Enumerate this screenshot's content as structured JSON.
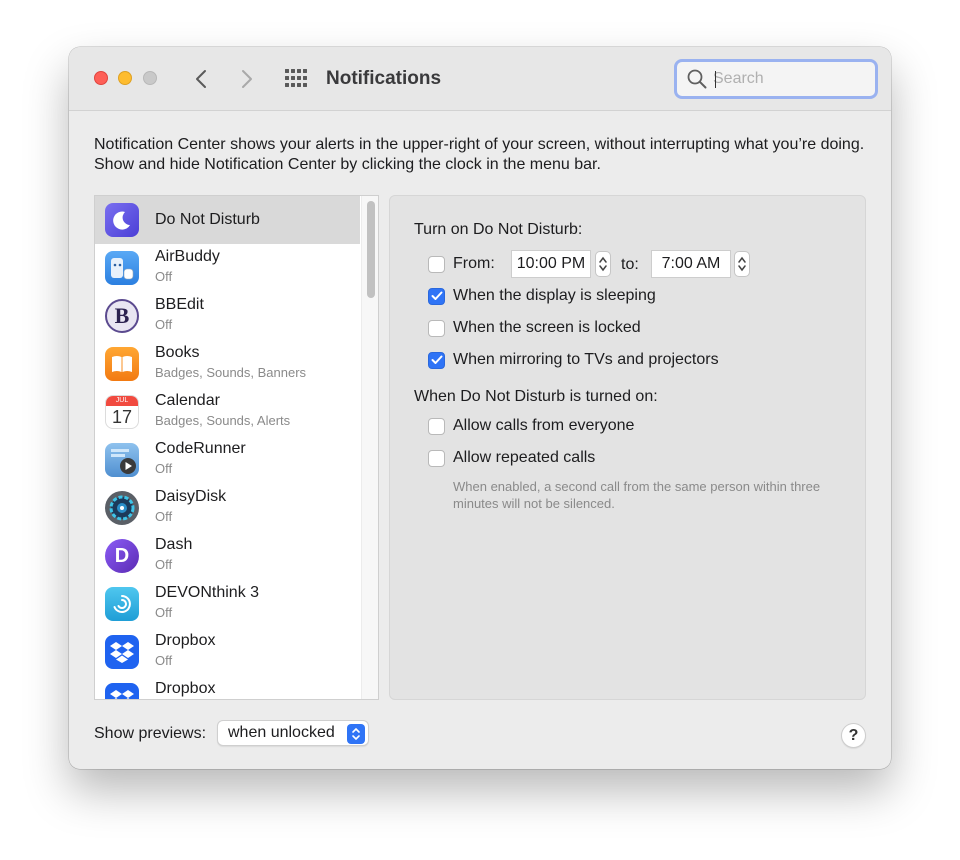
{
  "window": {
    "title": "Notifications",
    "search": {
      "placeholder": "Search",
      "value": ""
    }
  },
  "intro_text": "Notification Center shows your alerts in the upper-right of your screen, without interrupting what you’re doing. Show and hide Notification Center by clicking the clock in the menu bar.",
  "apps": [
    {
      "name": "Do Not Disturb",
      "subtitle": "",
      "icon": "moon-icon",
      "selected": true
    },
    {
      "name": "AirBuddy",
      "subtitle": "Off",
      "icon": "airbuddy-icon"
    },
    {
      "name": "BBEdit",
      "subtitle": "Off",
      "icon": "bbedit-icon"
    },
    {
      "name": "Books",
      "subtitle": "Badges, Sounds, Banners",
      "icon": "books-icon"
    },
    {
      "name": "Calendar",
      "subtitle": "Badges, Sounds, Alerts",
      "icon": "calendar-icon",
      "icon_month": "JUL",
      "icon_day": "17"
    },
    {
      "name": "CodeRunner",
      "subtitle": "Off",
      "icon": "coderunner-icon"
    },
    {
      "name": "DaisyDisk",
      "subtitle": "Off",
      "icon": "daisydisk-icon"
    },
    {
      "name": "Dash",
      "subtitle": "Off",
      "icon": "dash-icon"
    },
    {
      "name": "DEVONthink 3",
      "subtitle": "Off",
      "icon": "devonthink-icon"
    },
    {
      "name": "Dropbox",
      "subtitle": "Off",
      "icon": "dropbox-icon"
    },
    {
      "name": "Dropbox",
      "subtitle": "",
      "icon": "dropbox-icon"
    }
  ],
  "dnd": {
    "turn_on_heading": "Turn on Do Not Disturb:",
    "from_label": "From:",
    "from_time": "10:00 PM",
    "to_label": "to:",
    "to_time": "7:00 AM",
    "from_checked": false,
    "options": [
      {
        "label": "When the display is sleeping",
        "checked": true
      },
      {
        "label": "When the screen is locked",
        "checked": false
      },
      {
        "label": "When mirroring to TVs and projectors",
        "checked": true
      }
    ],
    "turned_on_heading": "When Do Not Disturb is turned on:",
    "allow_options": [
      {
        "label": "Allow calls from everyone",
        "checked": false
      },
      {
        "label": "Allow repeated calls",
        "checked": false
      }
    ],
    "helper_text": "When enabled, a second call from the same person within three minutes will not be silenced."
  },
  "footer": {
    "show_previews_label": "Show previews:",
    "show_previews_value": "when unlocked",
    "help_label": "?"
  },
  "colors": {
    "accent": "#2f74f6",
    "search_focus_ring": "#9ab2f0",
    "close": "#fe5f57",
    "minimize": "#febc2e",
    "zoom_disabled": "#c9c9c9"
  }
}
